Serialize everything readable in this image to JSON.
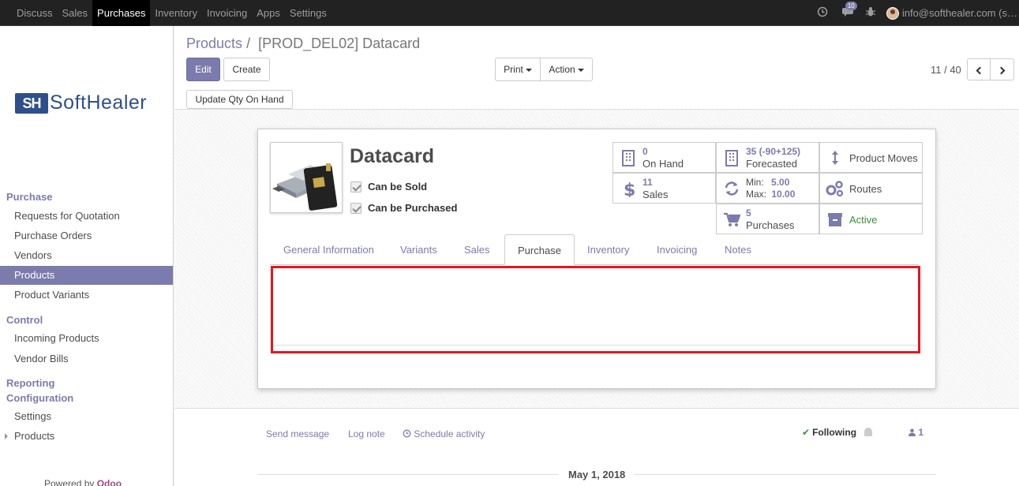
{
  "navbar": {
    "menu": [
      "Discuss",
      "Sales",
      "Purchases",
      "Inventory",
      "Invoicing",
      "Apps",
      "Settings"
    ],
    "active": "Purchases",
    "message_count": "10",
    "user": "info@softhealer.com (s…"
  },
  "sidebar": {
    "logo": {
      "mark": "SH",
      "text": "SoftHealer"
    },
    "sections": [
      {
        "title": "Purchase",
        "items": [
          "Requests for Quotation",
          "Purchase Orders",
          "Vendors",
          "Products",
          "Product Variants"
        ]
      },
      {
        "title": "Control",
        "items": [
          "Incoming Products",
          "Vendor Bills"
        ]
      },
      {
        "title": "Reporting",
        "items": []
      },
      {
        "title": "Configuration",
        "items": [
          "Settings",
          "Products"
        ]
      }
    ],
    "active_item": "Products",
    "powered_by": "Powered by",
    "powered_brand": "Odoo"
  },
  "breadcrumb": {
    "parent": "Products",
    "separator": "/",
    "current": "[PROD_DEL02] Datacard"
  },
  "buttons": {
    "edit": "Edit",
    "create": "Create",
    "print": "Print",
    "action": "Action",
    "update_qty": "Update Qty On Hand"
  },
  "pager": {
    "value": "11 / 40"
  },
  "product": {
    "name": "Datacard",
    "can_be_sold": "Can be Sold",
    "can_be_purchased": "Can be Purchased"
  },
  "smart_buttons": {
    "on_hand": {
      "value": "0",
      "label": "On Hand"
    },
    "forecasted": {
      "value": "35 (-90+125)",
      "label": "Forecasted"
    },
    "product_moves": {
      "label": "Product Moves"
    },
    "sales": {
      "value": "11",
      "label": "Sales"
    },
    "reorder": {
      "min_label": "Min:",
      "min": "5.00",
      "max_label": "Max:",
      "max": "10.00"
    },
    "routes": {
      "label": "Routes"
    },
    "purchases": {
      "value": "5",
      "label": "Purchases"
    },
    "active": {
      "label": "Active"
    }
  },
  "tabs": [
    "General Information",
    "Variants",
    "Sales",
    "Purchase",
    "Inventory",
    "Invoicing",
    "Notes"
  ],
  "active_tab": "Purchase",
  "chatter": {
    "send_message": "Send message",
    "log_note": "Log note",
    "schedule_activity": "Schedule activity",
    "following": "Following",
    "followers": "1",
    "date": "May 1, 2018"
  },
  "colors": {
    "brand": "#7c7bad",
    "highlight": "#e8141e",
    "active_status": "#3a8f3a"
  }
}
